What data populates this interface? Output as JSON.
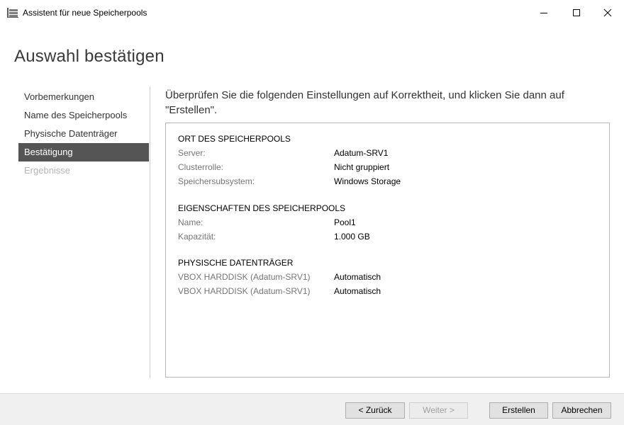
{
  "window": {
    "title": "Assistent für neue Speicherpools"
  },
  "page": {
    "title": "Auswahl bestätigen",
    "intro": "Überprüfen Sie die folgenden Einstellungen auf Korrektheit, und klicken Sie dann auf \"Erstellen\"."
  },
  "nav": {
    "items": [
      {
        "label": "Vorbemerkungen",
        "state": "normal"
      },
      {
        "label": "Name des Speicherpools",
        "state": "normal"
      },
      {
        "label": "Physische Datenträger",
        "state": "normal"
      },
      {
        "label": "Bestätigung",
        "state": "active"
      },
      {
        "label": "Ergebnisse",
        "state": "disabled"
      }
    ]
  },
  "details": {
    "location": {
      "title": "ORT DES SPEICHERPOOLS",
      "rows": [
        {
          "key": "Server:",
          "value": "Adatum-SRV1"
        },
        {
          "key": "Clusterrolle:",
          "value": "Nicht gruppiert"
        },
        {
          "key": "Speichersubsystem:",
          "value": "Windows Storage"
        }
      ]
    },
    "properties": {
      "title": "EIGENSCHAFTEN DES SPEICHERPOOLS",
      "rows": [
        {
          "key": "Name:",
          "value": "Pool1"
        },
        {
          "key": "Kapazität:",
          "value": "1.000 GB"
        }
      ]
    },
    "disks": {
      "title": "PHYSISCHE DATENTRÄGER",
      "rows": [
        {
          "key": "VBOX HARDDISK (Adatum-SRV1)",
          "value": "Automatisch"
        },
        {
          "key": "VBOX HARDDISK (Adatum-SRV1)",
          "value": "Automatisch"
        }
      ]
    }
  },
  "footer": {
    "back_label": "< Zurück",
    "next_label": "Weiter >",
    "create_label": "Erstellen",
    "cancel_label": "Abbrechen"
  },
  "colors": {
    "nav_active_bg": "#555555",
    "footer_bg": "#f0f0f0"
  }
}
